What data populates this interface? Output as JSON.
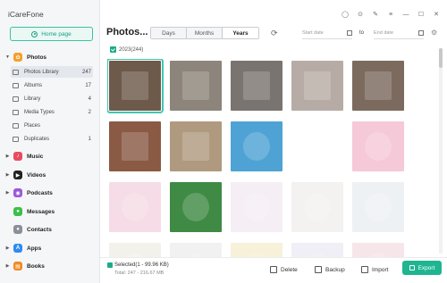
{
  "app": {
    "title": "iCareFone"
  },
  "sidebar": {
    "home_button": "Home page",
    "categories": [
      {
        "label": "Photos",
        "icon": "photos-icon",
        "color": "#f4a02b",
        "expanded": true
      },
      {
        "label": "Music",
        "icon": "music-icon",
        "color": "#e84b5d"
      },
      {
        "label": "Videos",
        "icon": "videos-icon",
        "color": "#222222"
      },
      {
        "label": "Podcasts",
        "icon": "podcasts-icon",
        "color": "#9b59d6"
      },
      {
        "label": "Messages",
        "icon": "messages-icon",
        "color": "#3bc04a"
      },
      {
        "label": "Contacts",
        "icon": "contacts-icon",
        "color": "#8a8f99"
      },
      {
        "label": "Apps",
        "icon": "apps-icon",
        "color": "#2d8cf0"
      },
      {
        "label": "Books",
        "icon": "books-icon",
        "color": "#f08a24"
      }
    ],
    "photo_subitems": [
      {
        "label": "Photos Library",
        "count": "247",
        "active": true
      },
      {
        "label": "Albums",
        "count": "17"
      },
      {
        "label": "Library",
        "count": "4"
      },
      {
        "label": "Media Types",
        "count": "2"
      },
      {
        "label": "Places",
        "count": ""
      },
      {
        "label": "Duplicates",
        "count": "1"
      }
    ]
  },
  "header": {
    "title": "Photos...",
    "segments": [
      "Days",
      "Months",
      "Years"
    ],
    "active_segment": "Years",
    "start_date_placeholder": "Start date",
    "to_label": "to",
    "end_date_placeholder": "End date"
  },
  "year_group": {
    "label": "2023(244)"
  },
  "thumbnails": [
    {
      "desc": "dark city street buildings",
      "bg": "#6d5a4b",
      "sel": true
    },
    {
      "desc": "interior room grey",
      "bg": "#8d857b"
    },
    {
      "desc": "tall buildings street",
      "bg": "#7a7470"
    },
    {
      "desc": "person lying down",
      "bg": "#b7aca5"
    },
    {
      "desc": "city skyline dusk",
      "bg": "#7c6a5e"
    },
    {
      "desc": "window sunset",
      "bg": "#8a5a45"
    },
    {
      "desc": "figure by window",
      "bg": "#b09a7f"
    },
    {
      "desc": "cartoon hat character blue",
      "bg": "#4fa3d4"
    },
    {
      "desc": "cartoon dog outline",
      "bg": "#ffffff"
    },
    {
      "desc": "cartoon unicorn cloud",
      "bg": "#f6c9d8"
    },
    {
      "desc": "cartoon star character",
      "bg": "#f6dce6"
    },
    {
      "desc": "forest gate green",
      "bg": "#3f8a45"
    },
    {
      "desc": "cartoon mushroom character",
      "bg": "#f5eef5"
    },
    {
      "desc": "cartoon pink mushroom girl",
      "bg": "#f4f2f0"
    },
    {
      "desc": "cartoon girl red hat",
      "bg": "#eef1f4"
    },
    {
      "desc": "cartoon green partial",
      "bg": "#f3f2ea"
    },
    {
      "desc": "cartoon dark partial",
      "bg": "#f1f1f1"
    },
    {
      "desc": "cartoon yellow partial",
      "bg": "#f7f1d9"
    },
    {
      "desc": "cartoon rainbow partial",
      "bg": "#f0eef7"
    },
    {
      "desc": "cartoon pink partial",
      "bg": "#f6e6ea"
    }
  ],
  "footer": {
    "selected_text": "Selected(1 - 99.96 KB)",
    "total_text": "Total: 247 - 216.67 MB",
    "actions": [
      "Delete",
      "Backup",
      "Import"
    ],
    "export_label": "Export"
  },
  "colors": {
    "accent": "#1fb591",
    "accent_light": "#eaf8f4",
    "selection_outline": "#41c6b0"
  }
}
